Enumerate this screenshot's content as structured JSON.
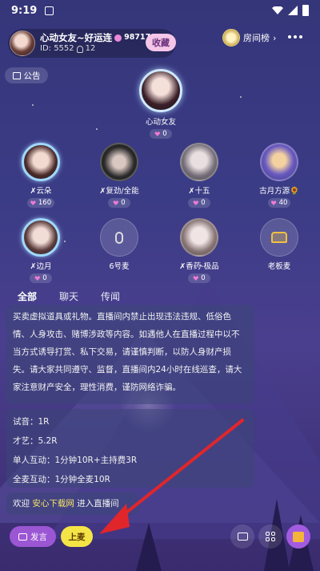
{
  "status": {
    "time": "9:19"
  },
  "room": {
    "title": "心动女友~好运连",
    "member_count": "987179",
    "id_label": "ID: 5552",
    "online": "12",
    "collect_label": "收藏",
    "rank_label": "房间榜"
  },
  "notice_label": "公告",
  "host": {
    "name": "心动女友",
    "score": "0"
  },
  "seats": [
    {
      "name": "✗云朵",
      "score": "160"
    },
    {
      "name": "✗复劲/全能",
      "score": "0"
    },
    {
      "name": "✗十五",
      "score": "0"
    },
    {
      "name": "古月方源🌻",
      "score": "40"
    },
    {
      "name": "✗边月",
      "score": "0"
    },
    {
      "name": "6号麦",
      "score": ""
    },
    {
      "name": "✗香药-极品",
      "score": "0"
    },
    {
      "name": "老板麦",
      "score": ""
    }
  ],
  "tabs": [
    "全部",
    "聊天",
    "传闻"
  ],
  "chat": {
    "rules_lines": [
      "买卖虚拟道具或礼物。直播间内禁止出现违法违规、低俗色",
      "情、人身攻击、赌博涉政等内容。如遇他人在直播过程中以不",
      "当方式诱导打赏、私下交易，请谨慎判断，以防人身财产损",
      "失。请大家共同遵守、监督，直播间内24小时在线巡查，请大",
      "家注意财产安全，理性消费，谨防网络诈骗。"
    ],
    "price_lines": [
      "试音：1R",
      "才艺：5.2R",
      "单人互动：1分钟10R+主持费3R",
      "全麦互动：1分钟全麦10R"
    ],
    "welcome_prefix": "欢迎",
    "welcome_site": "安心下载网",
    "welcome_suffix": "进入直播间"
  },
  "bottom": {
    "speak_label": "发言",
    "mic_label": "上麦"
  },
  "colors": {
    "speak": "#9b56d4",
    "mic": "#f5e446",
    "arrow": "#e0262b",
    "highlight": "#f7e36a"
  }
}
